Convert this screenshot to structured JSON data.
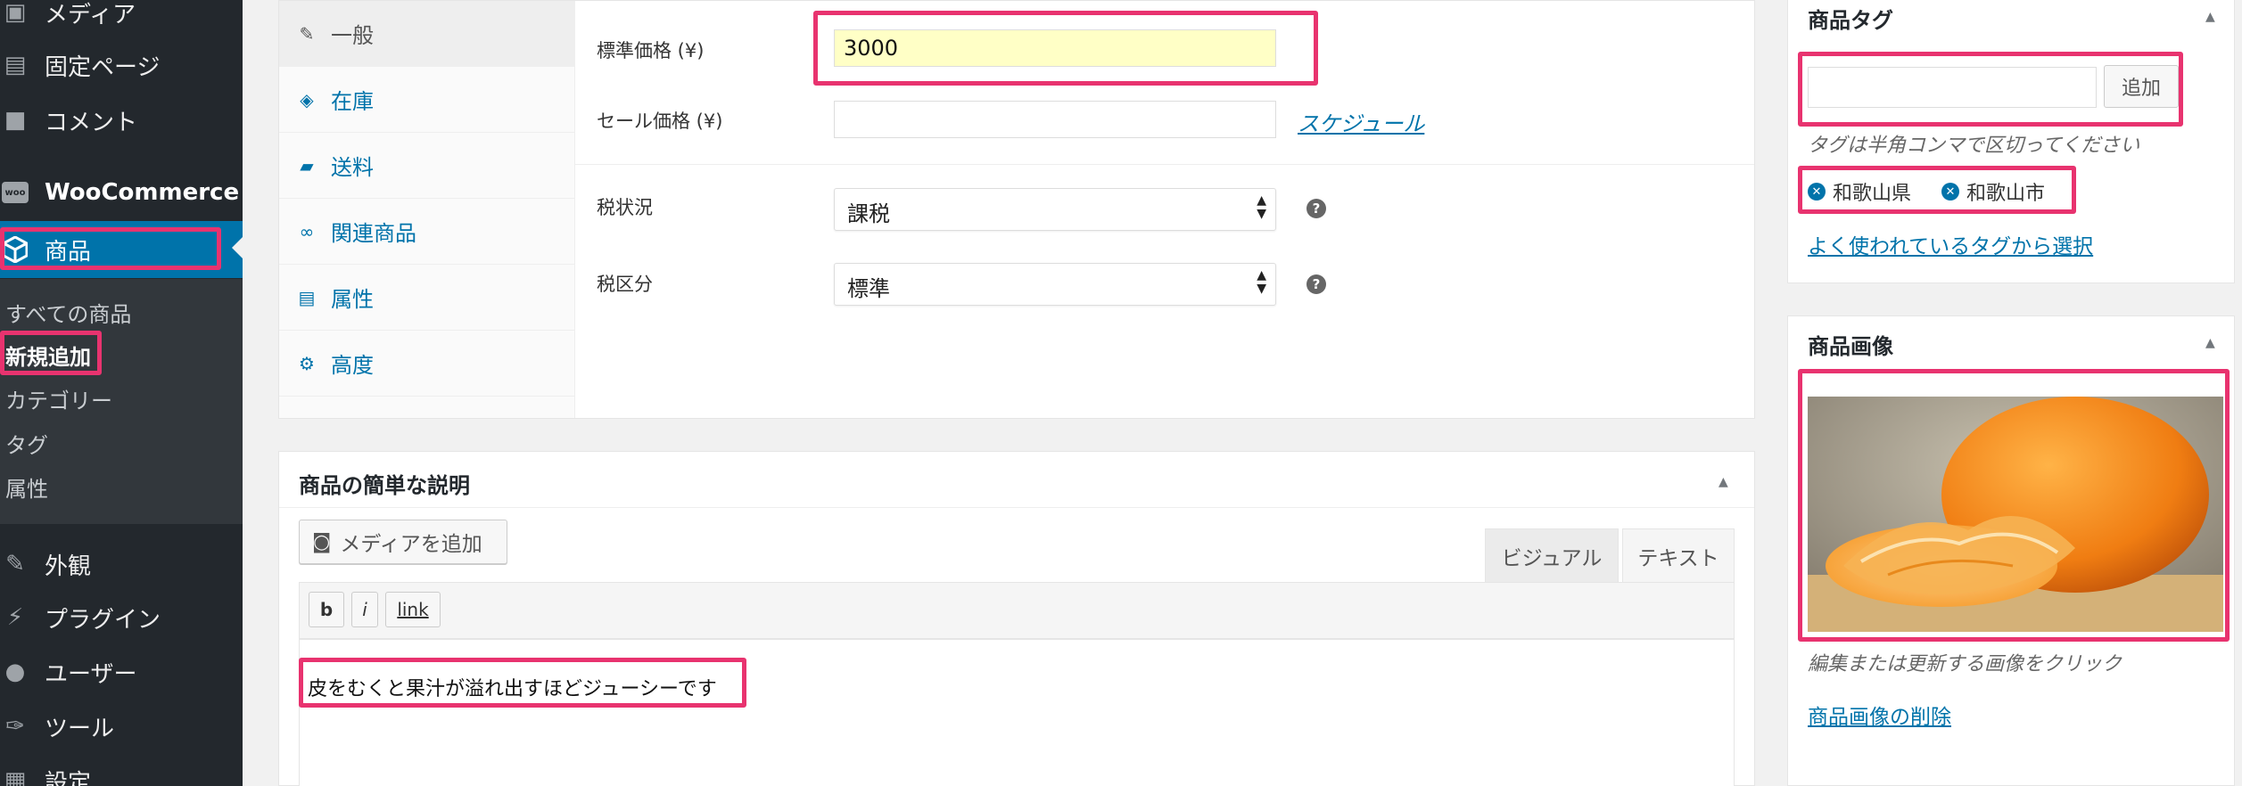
{
  "sidebar": {
    "items": [
      {
        "label": "メディア",
        "icon": "media-icon"
      },
      {
        "label": "固定ページ",
        "icon": "page-icon"
      },
      {
        "label": "コメント",
        "icon": "comment-icon"
      },
      {
        "label": "WooCommerce",
        "icon": "woo-icon",
        "icon_text": "woo"
      },
      {
        "label": "商品",
        "icon": "product-icon"
      },
      {
        "label": "外観",
        "icon": "appearance-icon"
      },
      {
        "label": "プラグイン",
        "icon": "plugin-icon"
      },
      {
        "label": "ユーザー",
        "icon": "user-icon"
      },
      {
        "label": "ツール",
        "icon": "tool-icon"
      },
      {
        "label": "設定",
        "icon": "settings-icon"
      }
    ],
    "submenu": [
      "すべての商品",
      "新規追加",
      "カテゴリー",
      "タグ",
      "属性"
    ],
    "active_submenu": "新規追加",
    "accent_color": "#0073aa"
  },
  "product_data": {
    "tabs": [
      {
        "label": "一般",
        "icon": "wrench-icon"
      },
      {
        "label": "在庫",
        "icon": "tag-icon"
      },
      {
        "label": "送料",
        "icon": "truck-icon"
      },
      {
        "label": "関連商品",
        "icon": "link-icon"
      },
      {
        "label": "属性",
        "icon": "list-icon"
      },
      {
        "label": "高度",
        "icon": "gear-icon"
      }
    ],
    "active_tab": "一般",
    "regular_price_label": "標準価格 (¥)",
    "regular_price_value": "3000",
    "sale_price_label": "セール価格 (¥)",
    "sale_price_value": "",
    "schedule_link": "スケジュール",
    "tax_status_label": "税状況",
    "tax_status_value": "課税",
    "tax_class_label": "税区分",
    "tax_class_value": "標準"
  },
  "short_description": {
    "title": "商品の簡単な説明",
    "add_media": "メディアを追加",
    "tab_visual": "ビジュアル",
    "tab_text": "テキスト",
    "quicktags": [
      "b",
      "i",
      "link"
    ],
    "content": "皮をむくと果汁が溢れ出すほどジューシーです"
  },
  "product_tags": {
    "title": "商品タグ",
    "input_value": "",
    "add_button": "追加",
    "hint": "タグは半角コンマで区切ってください",
    "tags": [
      "和歌山県",
      "和歌山市"
    ],
    "popular_link": "よく使われているタグから選択"
  },
  "product_image": {
    "title": "商品画像",
    "image_subject": "mandarin-orange-photo",
    "hint": "編集または更新する画像をクリック",
    "remove_link": "商品画像の削除"
  },
  "colors": {
    "highlight": "#e8336f",
    "link": "#0073aa",
    "admin_bar": "#23282d",
    "price_field_bg": "#ffffc6"
  }
}
